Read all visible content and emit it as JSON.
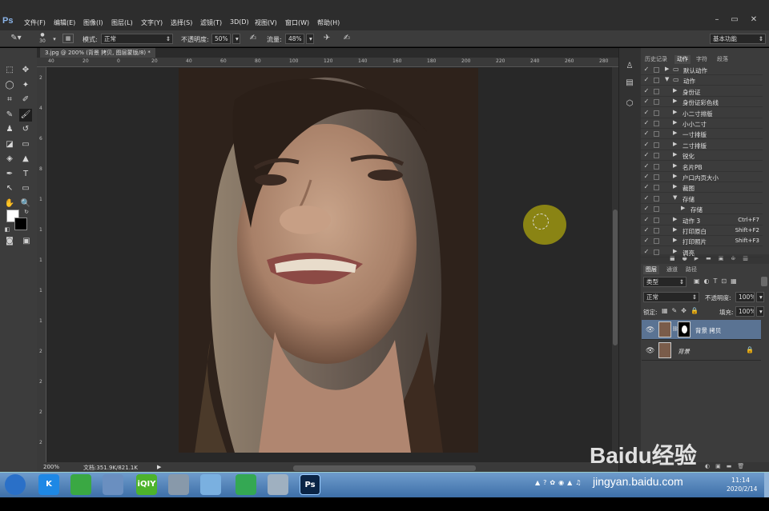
{
  "app": {
    "logo": "Ps"
  },
  "menu": [
    "文件(F)",
    "编辑(E)",
    "图像(I)",
    "图层(L)",
    "文字(Y)",
    "选择(S)",
    "滤镜(T)",
    "3D(D)",
    "视图(V)",
    "窗口(W)",
    "帮助(H)"
  ],
  "options": {
    "brush_size": "30",
    "mode_label": "模式:",
    "mode_value": "正常",
    "opacity_label": "不透明度:",
    "opacity_value": "50%",
    "flow_label": "流量:",
    "flow_value": "48%",
    "workspace": "基本功能"
  },
  "document": {
    "tab_title": "3.jpg @ 200% (背景 拷贝, 图层蒙版/8) *",
    "ruler_top": [
      "40",
      "20",
      "0",
      "20",
      "40",
      "60",
      "80",
      "100",
      "120",
      "140",
      "160",
      "180",
      "200",
      "220",
      "240",
      "260",
      "280"
    ],
    "ruler_left": [
      "2",
      "4",
      "6",
      "8",
      "1",
      "1",
      "1",
      "1",
      "1",
      "2",
      "2",
      "2",
      "2"
    ],
    "zoom": "200%",
    "doc_info": "文档:351.9K/821.1K"
  },
  "panels": {
    "top_tabs": [
      "历史记录",
      "动作",
      "字符",
      "段落"
    ],
    "actions": [
      {
        "label": "默认动作",
        "indent": 0,
        "folder": true,
        "open": false
      },
      {
        "label": "动作",
        "indent": 0,
        "folder": true,
        "open": true
      },
      {
        "label": "身份证",
        "indent": 1
      },
      {
        "label": "身份证彩色线",
        "indent": 1
      },
      {
        "label": "小二寸排版",
        "indent": 1
      },
      {
        "label": "小小二寸",
        "indent": 1
      },
      {
        "label": "一寸排版",
        "indent": 1
      },
      {
        "label": "二寸排版",
        "indent": 1
      },
      {
        "label": "锐化",
        "indent": 1
      },
      {
        "label": "名片PB",
        "indent": 1
      },
      {
        "label": "户口内页大小",
        "indent": 1
      },
      {
        "label": "裁图",
        "indent": 1
      },
      {
        "label": "存储",
        "indent": 1,
        "open": true
      },
      {
        "label": "存储",
        "indent": 2
      },
      {
        "label": "动作 3",
        "indent": 1,
        "shortcut": "Ctrl+F7"
      },
      {
        "label": "打印原白",
        "indent": 1,
        "shortcut": "Shift+F2"
      },
      {
        "label": "打印照片",
        "indent": 1,
        "shortcut": "Shift+F3"
      },
      {
        "label": "调亮",
        "indent": 1
      }
    ],
    "layer_tabs": [
      "图层",
      "通道",
      "路径"
    ],
    "filter_label": "类型",
    "blend_mode": "正常",
    "opacity_label": "不透明度:",
    "opacity_value": "100%",
    "lock_label": "锁定:",
    "fill_label": "填充:",
    "fill_value": "100%",
    "layers": [
      {
        "name": "背景 拷贝",
        "selected": true,
        "mask": true
      },
      {
        "name": "背景",
        "selected": false,
        "locked": true
      }
    ]
  },
  "taskbar": {
    "items": [
      {
        "icon": "start-orb-icon",
        "color": "#2a70c8"
      },
      {
        "icon": "k-app-icon",
        "color": "#1e88e5",
        "text": "K"
      },
      {
        "icon": "wechat-icon",
        "color": "#3aa843"
      },
      {
        "icon": "bird-app-icon",
        "color": "#6a8fc0"
      },
      {
        "icon": "iqiyi-icon",
        "color": "#4db32c",
        "text": "iQIY"
      },
      {
        "icon": "calculator-icon",
        "color": "#8899aa"
      },
      {
        "icon": "mail-app-icon",
        "color": "#7ab0e0"
      },
      {
        "icon": "360-browser-icon",
        "color": "#34a853"
      },
      {
        "icon": "window-app-icon",
        "color": "#9fb0c0"
      },
      {
        "icon": "photoshop-icon",
        "color": "#0a2445",
        "text": "Ps"
      }
    ],
    "time": "11:14",
    "date": "2020/2/14"
  },
  "watermark": {
    "brand": "Baidu经验",
    "url": "jingyan.baidu.com"
  }
}
